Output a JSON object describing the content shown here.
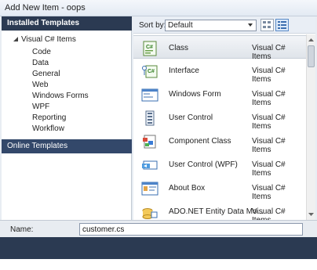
{
  "window": {
    "title": "Add New Item - oops"
  },
  "left": {
    "installed_header": "Installed Templates",
    "root": "Visual C# Items",
    "children": [
      "Code",
      "Data",
      "General",
      "Web",
      "Windows Forms",
      "WPF",
      "Reporting",
      "Workflow"
    ],
    "online_header": "Online Templates"
  },
  "sort": {
    "label": "Sort by:",
    "value": "Default"
  },
  "items": [
    {
      "name": "Class",
      "category": "Visual C# Items",
      "icon": "class-icon",
      "selected": true
    },
    {
      "name": "Interface",
      "category": "Visual C# Items",
      "icon": "interface-icon"
    },
    {
      "name": "Windows Form",
      "category": "Visual C# Items",
      "icon": "windows-form-icon"
    },
    {
      "name": "User Control",
      "category": "Visual C# Items",
      "icon": "user-control-icon"
    },
    {
      "name": "Component Class",
      "category": "Visual C# Items",
      "icon": "component-class-icon"
    },
    {
      "name": "User Control (WPF)",
      "category": "Visual C# Items",
      "icon": "wpf-user-control-icon"
    },
    {
      "name": "About Box",
      "category": "Visual C# Items",
      "icon": "about-box-icon"
    },
    {
      "name": "ADO.NET Entity Data Mo...",
      "category": "Visual C# Items",
      "icon": "ado-net-icon"
    }
  ],
  "name_row": {
    "label": "Name:",
    "value": "customer.cs"
  }
}
